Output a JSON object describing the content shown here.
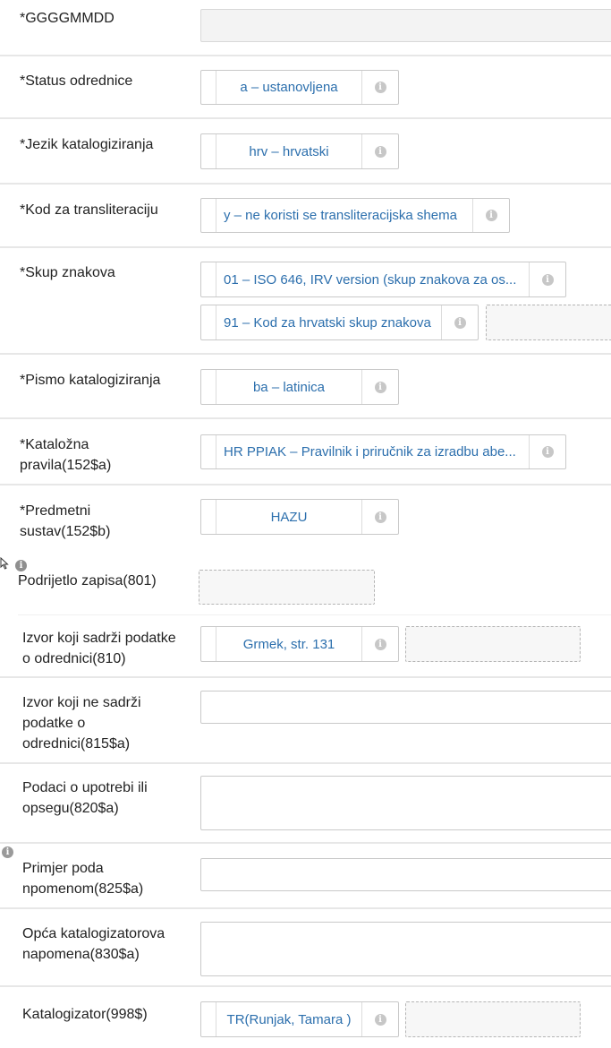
{
  "fields": {
    "date": {
      "label": "*GGGGMMDD"
    },
    "status": {
      "label": "*Status odrednice",
      "value": "a – ustanovljena",
      "icon": "info-icon"
    },
    "language": {
      "label": "*Jezik katalogiziranja",
      "value": "hrv – hrvatski",
      "icon": "info-icon"
    },
    "translit": {
      "label": "*Kod za transliteraciju",
      "value": "y – ne koristi se transliteracijska shema",
      "icon": "info-icon"
    },
    "charset": {
      "label": "*Skup znakova",
      "value1": "01 – ISO 646, IRV version (skup znakova za os...",
      "value2": "91 – Kod za hrvatski skup znakova",
      "icon": "info-icon"
    },
    "script": {
      "label": "*Pismo katalogiziranja",
      "value": "ba – latinica",
      "icon": "info-icon"
    },
    "rules": {
      "label_line1": "*Kataložna",
      "label_line2": "pravila(152$a)",
      "value": "HR PPIAK – Pravilnik i priručnik za izradbu abe...",
      "icon": "info-icon"
    },
    "subject": {
      "label_line1": "*Predmetni",
      "label_line2": "sustav(152$b)",
      "value": "HAZU",
      "icon": "info-icon"
    },
    "origin": {
      "label": "Podrijetlo zapisa(801)",
      "icon": "info-icon"
    },
    "source_with": {
      "label_line1": "Izvor koji sadrži podatke",
      "label_line2": "o odrednici(810)",
      "value": "Grmek, str. 131",
      "icon": "info-icon"
    },
    "source_without": {
      "label_line1": "Izvor koji ne sadrži",
      "label_line2": "podatke o",
      "label_line3": "odrednici(815$a)"
    },
    "usage": {
      "label_line1": "Podaci o upotrebi ili",
      "label_line2": "opsegu(820$a)"
    },
    "example": {
      "label_line1": "Primjer poda",
      "label_line2": "npomenom(825$a)",
      "icon": "info-icon"
    },
    "note": {
      "label_line1": "Opća katalogizatorova",
      "label_line2": "napomena(830$a)"
    },
    "cataloger": {
      "label": "Katalogizator(998$)",
      "value": "TR(Runjak, Tamara )",
      "icon": "info-icon"
    }
  },
  "info_glyph": "i"
}
